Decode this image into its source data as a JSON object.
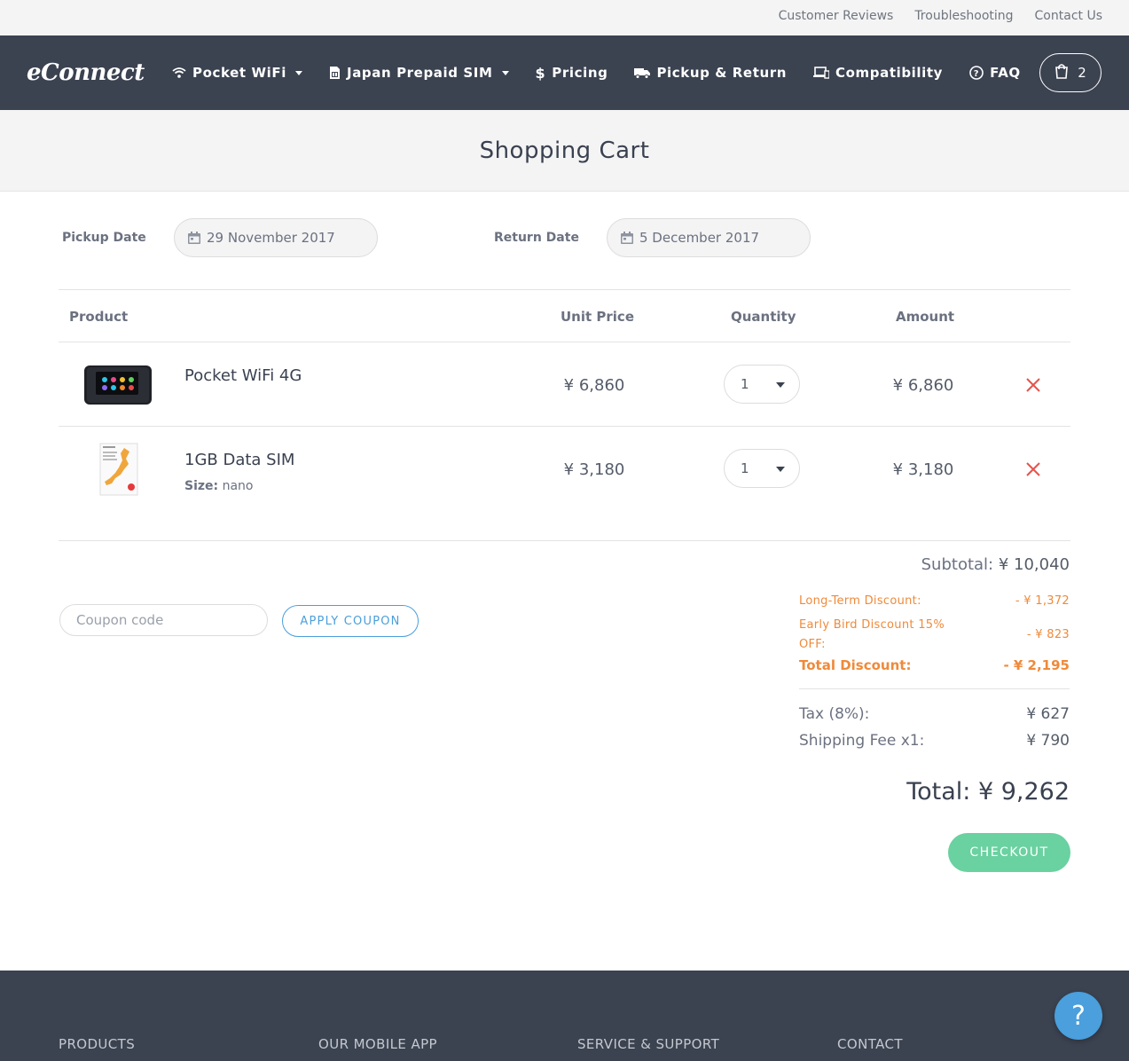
{
  "toplinks": {
    "reviews": "Customer Reviews",
    "troubleshooting": "Troubleshooting",
    "contact": "Contact Us"
  },
  "nav": {
    "logo": "eConnect",
    "items": [
      {
        "label": "Pocket WiFi",
        "icon": "wifi-icon"
      },
      {
        "label": "Japan Prepaid SIM",
        "icon": "sim-card-icon"
      },
      {
        "label": "Pricing",
        "icon": "dollar-icon"
      },
      {
        "label": "Pickup & Return",
        "icon": "truck-icon"
      },
      {
        "label": "Compatibility",
        "icon": "devices-icon"
      },
      {
        "label": "FAQ",
        "icon": "question-circle-icon"
      }
    ],
    "cart_count": "2"
  },
  "page_title": "Shopping Cart",
  "dates": {
    "pickup_label": "Pickup Date",
    "pickup_value": "29 November 2017",
    "return_label": "Return Date",
    "return_value": "5 December 2017"
  },
  "table": {
    "headers": {
      "product": "Product",
      "unit_price": "Unit Price",
      "quantity": "Quantity",
      "amount": "Amount"
    },
    "rows": [
      {
        "name": "Pocket WiFi 4G",
        "unit_price": "¥ 6,860",
        "quantity": "1",
        "amount": "¥ 6,860"
      },
      {
        "name": "1GB Data SIM",
        "size_label": "Size:",
        "size_value": "nano",
        "unit_price": "¥ 3,180",
        "quantity": "1",
        "amount": "¥ 3,180"
      }
    ]
  },
  "coupon": {
    "placeholder": "Coupon code",
    "button": "APPLY COUPON"
  },
  "summary": {
    "subtotal_label": "Subtotal:",
    "subtotal_value": "¥ 10,040",
    "long_term_label": "Long-Term Discount:",
    "long_term_value": "- ¥ 1,372",
    "early_bird_label_1": "Early Bird Discount 15%",
    "early_bird_label_2": "OFF:",
    "early_bird_value": "- ¥ 823",
    "total_discount_label": "Total Discount:",
    "total_discount_value": "- ¥ 2,195",
    "tax_label": "Tax (8%):",
    "tax_value": "¥ 627",
    "shipping_label": "Shipping Fee x1:",
    "shipping_value": "¥ 790",
    "total_label": "Total:",
    "total_value": "¥ 9,262",
    "checkout": "CHECKOUT"
  },
  "footer": {
    "products": "PRODUCTS",
    "app": "OUR MOBILE APP",
    "support": "SERVICE & SUPPORT",
    "contact": "CONTACT"
  },
  "help_label": "?",
  "colors": {
    "nav_bg": "#3b4250",
    "accent_blue": "#4a9fdc",
    "discount_orange": "#ef8a3a",
    "checkout_green": "#6ad1a0",
    "remove_red": "#e5534b"
  }
}
